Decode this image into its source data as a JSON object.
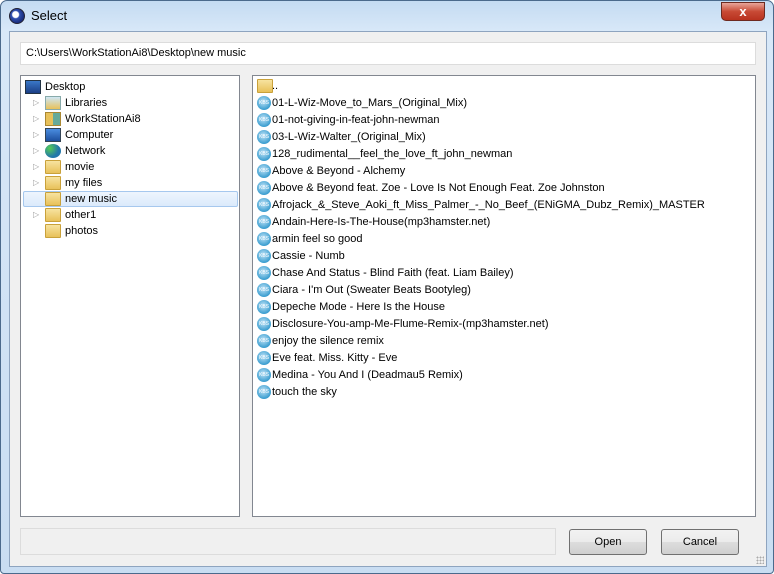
{
  "window": {
    "title": "Select",
    "close_label": "x"
  },
  "path": "C:\\Users\\WorkStationAi8\\Desktop\\new music",
  "tree": [
    {
      "label": "Desktop",
      "icon": "desktop-icon",
      "level": 0,
      "expander": false
    },
    {
      "label": "Libraries",
      "icon": "libraries-icon",
      "level": 1,
      "expander": true
    },
    {
      "label": "WorkStationAi8",
      "icon": "user-folder-icon",
      "level": 1,
      "expander": true
    },
    {
      "label": "Computer",
      "icon": "computer-icon",
      "level": 1,
      "expander": true
    },
    {
      "label": "Network",
      "icon": "network-icon",
      "level": 1,
      "expander": true
    },
    {
      "label": "movie",
      "icon": "folder-icon",
      "level": 1,
      "expander": true
    },
    {
      "label": "my files",
      "icon": "folder-icon",
      "level": 1,
      "expander": true
    },
    {
      "label": "new music",
      "icon": "folder-icon",
      "level": 1,
      "expander": false,
      "selected": true
    },
    {
      "label": "other1",
      "icon": "folder-icon",
      "level": 1,
      "expander": true
    },
    {
      "label": "photos",
      "icon": "folder-icon",
      "level": 1,
      "expander": false
    }
  ],
  "files": [
    {
      "label": "..",
      "icon": "folder-icon"
    },
    {
      "label": "01-L-Wiz-Move_to_Mars_(Original_Mix)",
      "icon": "music-file-icon"
    },
    {
      "label": "01-not-giving-in-feat-john-newman",
      "icon": "music-file-icon"
    },
    {
      "label": "03-L-Wiz-Walter_(Original_Mix)",
      "icon": "music-file-icon"
    },
    {
      "label": "128_rudimental__feel_the_love_ft_john_newman",
      "icon": "music-file-icon"
    },
    {
      "label": "Above & Beyond - Alchemy",
      "icon": "music-file-icon"
    },
    {
      "label": "Above & Beyond feat. Zoe - Love Is Not Enough Feat. Zoe Johnston",
      "icon": "music-file-icon"
    },
    {
      "label": "Afrojack_&_Steve_Aoki_ft_Miss_Palmer_-_No_Beef_(ENiGMA_Dubz_Remix)_MASTER",
      "icon": "music-file-icon"
    },
    {
      "label": "Andain-Here-Is-The-House(mp3hamster.net)",
      "icon": "music-file-icon"
    },
    {
      "label": "armin feel so good",
      "icon": "music-file-icon"
    },
    {
      "label": "Cassie - Numb",
      "icon": "music-file-icon"
    },
    {
      "label": "Chase And Status - Blind Faith (feat. Liam Bailey)",
      "icon": "music-file-icon"
    },
    {
      "label": "Ciara - I'm Out (Sweater Beats Bootyleg)",
      "icon": "music-file-icon"
    },
    {
      "label": "Depeche Mode - Here Is the House",
      "icon": "music-file-icon"
    },
    {
      "label": "Disclosure-You-amp-Me-Flume-Remix-(mp3hamster.net)",
      "icon": "music-file-icon"
    },
    {
      "label": "enjoy the silence remix",
      "icon": "music-file-icon"
    },
    {
      "label": "Eve feat. Miss. Kitty - Eve",
      "icon": "music-file-icon"
    },
    {
      "label": "Medina - You And I (Deadmau5 Remix)",
      "icon": "music-file-icon"
    },
    {
      "label": "touch the sky",
      "icon": "music-file-icon"
    }
  ],
  "status_text": "",
  "buttons": {
    "open": "Open",
    "cancel": "Cancel"
  }
}
